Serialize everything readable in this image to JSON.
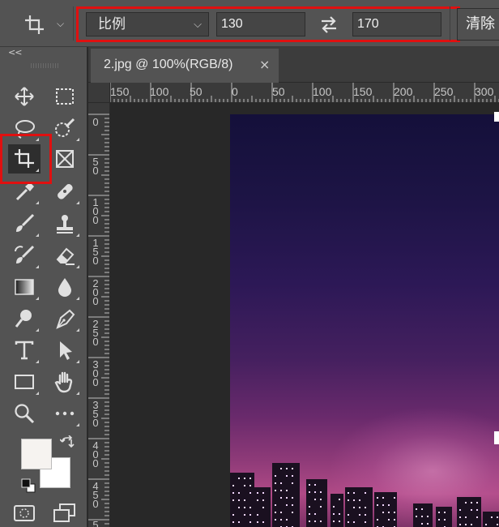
{
  "options_bar": {
    "tool_preset_icon": "crop-icon",
    "ratio_select": {
      "value": "比例"
    },
    "width_value": "130",
    "height_value": "170",
    "swap_icon": "swap-arrows-icon",
    "clear_button": "清除"
  },
  "toolbox": {
    "collapse_label": "<<",
    "tools": [
      {
        "name": "move-icon"
      },
      {
        "name": "rect-marquee-icon"
      },
      {
        "name": "lasso-icon"
      },
      {
        "name": "quick-select-icon"
      },
      {
        "name": "crop-icon",
        "active": true
      },
      {
        "name": "frame-icon"
      },
      {
        "name": "eyedropper-icon"
      },
      {
        "name": "healing-brush-icon"
      },
      {
        "name": "brush-icon"
      },
      {
        "name": "clone-stamp-icon"
      },
      {
        "name": "history-brush-icon"
      },
      {
        "name": "eraser-icon"
      },
      {
        "name": "gradient-icon"
      },
      {
        "name": "blur-icon"
      },
      {
        "name": "dodge-icon"
      },
      {
        "name": "pen-icon"
      },
      {
        "name": "type-icon"
      },
      {
        "name": "path-select-icon"
      },
      {
        "name": "rectangle-shape-icon"
      },
      {
        "name": "hand-icon"
      },
      {
        "name": "zoom-icon"
      },
      {
        "name": "more-tools-icon"
      }
    ],
    "foreground_color": "#f6f3f0",
    "background_color": "#ffffff"
  },
  "document": {
    "tab_title": "2.jpg @ 100%(RGB/8)",
    "close_glyph": "×"
  },
  "rulers": {
    "horizontal": [
      "150",
      "100",
      "50",
      "0",
      "50",
      "100",
      "150",
      "200",
      "250",
      "300"
    ],
    "vertical": [
      [
        "0"
      ],
      [
        "5",
        "0"
      ],
      [
        "1",
        "0",
        "0"
      ],
      [
        "1",
        "5",
        "0"
      ],
      [
        "2",
        "0",
        "0"
      ],
      [
        "2",
        "5",
        "0"
      ],
      [
        "3",
        "0",
        "0"
      ],
      [
        "3",
        "5",
        "0"
      ],
      [
        "4",
        "0",
        "0"
      ],
      [
        "4",
        "5",
        "0"
      ],
      [
        "5"
      ]
    ]
  },
  "colors": {
    "highlight": "#e01010",
    "panel": "#535353",
    "workspace": "#282828"
  }
}
